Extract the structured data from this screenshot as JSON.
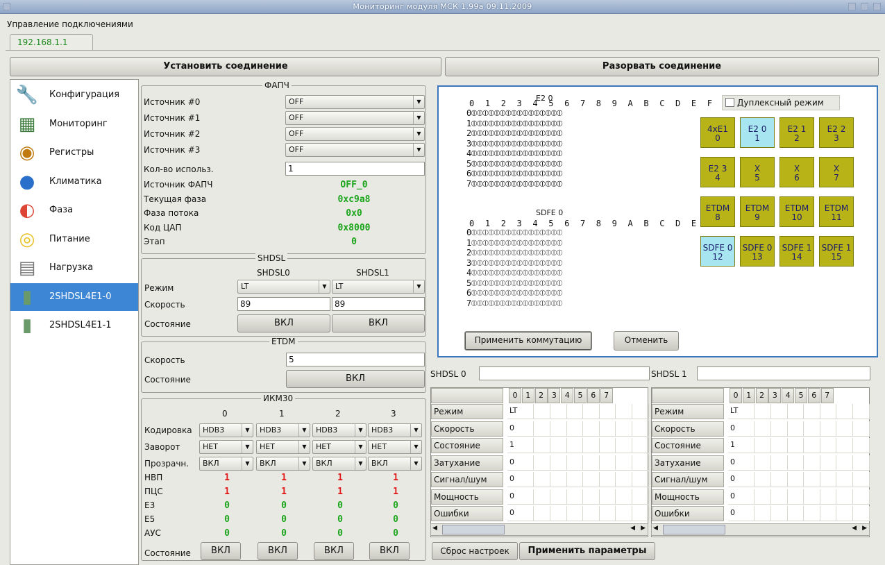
{
  "window": {
    "title": "Мониторинг модуля МСК 1.99а 09.11.2009"
  },
  "menu": {
    "label": "Управление подключениями"
  },
  "tab": {
    "label": "192.168.1.1"
  },
  "toolbar": {
    "connect": "Установить соединение",
    "disconnect": "Разорвать соединение"
  },
  "sidebar": {
    "items": [
      {
        "label": "Конфигурация",
        "icon": "wrench-icon"
      },
      {
        "label": "Мониторинг",
        "icon": "monitor-icon"
      },
      {
        "label": "Регистры",
        "icon": "registers-icon"
      },
      {
        "label": "Климатика",
        "icon": "globe-icon"
      },
      {
        "label": "Фаза",
        "icon": "phase-icon"
      },
      {
        "label": "Питание",
        "icon": "lightbulb-icon"
      },
      {
        "label": "Нагрузка",
        "icon": "server-icon"
      },
      {
        "label": "2SHDSL4E1-0",
        "icon": "board-icon"
      },
      {
        "label": "2SHDSL4E1-1",
        "icon": "board-icon"
      }
    ],
    "selected": 7
  },
  "pll": {
    "title": "ФАПЧ",
    "sources": [
      {
        "label": "Источник #0",
        "value": "OFF"
      },
      {
        "label": "Источник #1",
        "value": "OFF"
      },
      {
        "label": "Источник #2",
        "value": "OFF"
      },
      {
        "label": "Источник #3",
        "value": "OFF"
      }
    ],
    "used_label": "Кол-во использ.",
    "used_value": "1",
    "readouts": [
      {
        "label": "Источник ФАПЧ",
        "value": "OFF_0"
      },
      {
        "label": "Текущая фаза",
        "value": "0xc9a8"
      },
      {
        "label": "Фаза потока",
        "value": "0x0"
      },
      {
        "label": "Код ЦАП",
        "value": "0x8000"
      },
      {
        "label": "Этап",
        "value": "0"
      }
    ]
  },
  "shdsl": {
    "title": "SHDSL",
    "col0": "SHDSL0",
    "col1": "SHDSL1",
    "mode_label": "Режим",
    "mode0": "LT",
    "mode1": "LT",
    "speed_label": "Скорость",
    "speed0": "89",
    "speed1": "89",
    "state_label": "Состояние",
    "state0": "ВКЛ",
    "state1": "ВКЛ"
  },
  "etdm": {
    "title": "ETDM",
    "speed_label": "Скорость",
    "speed": "5",
    "state_label": "Состояние",
    "state": "ВКЛ"
  },
  "ikm": {
    "title": "ИКМ30",
    "cols": [
      "0",
      "1",
      "2",
      "3"
    ],
    "coding_label": "Кодировка",
    "coding": [
      "HDB3",
      "HDB3",
      "HDB3",
      "HDB3"
    ],
    "loop_label": "Заворот",
    "loop": [
      "НЕТ",
      "НЕТ",
      "НЕТ",
      "НЕТ"
    ],
    "transp_label": "Прозрачн.",
    "transp": [
      "ВКЛ",
      "ВКЛ",
      "ВКЛ",
      "ВКЛ"
    ],
    "counters": [
      {
        "label": "НВП",
        "values": [
          "1",
          "1",
          "1",
          "1"
        ],
        "color": "#e01818"
      },
      {
        "label": "ПЦС",
        "values": [
          "1",
          "1",
          "1",
          "1"
        ],
        "color": "#e01818"
      },
      {
        "label": "E3",
        "values": [
          "0",
          "0",
          "0",
          "0"
        ],
        "color": "#1aa51a"
      },
      {
        "label": "E5",
        "values": [
          "0",
          "0",
          "0",
          "0"
        ],
        "color": "#1aa51a"
      },
      {
        "label": "АУС",
        "values": [
          "0",
          "0",
          "0",
          "0"
        ],
        "color": "#1aa51a"
      }
    ],
    "state_label": "Состояние",
    "state": [
      "ВКЛ",
      "ВКЛ",
      "ВКЛ",
      "ВКЛ"
    ]
  },
  "matrix": {
    "e20_title": "E2 0",
    "sdfe_title": "SDFE 0",
    "header": "0123456789ABCDEF",
    "rows": [
      "0",
      "1",
      "2",
      "3",
      "4",
      "5",
      "6",
      "7"
    ],
    "duplex_label": "Дуплексный режим",
    "apply": "Применить коммутацию",
    "cancel": "Отменить",
    "cells": [
      {
        "name": "4xE1",
        "num": "0",
        "color": "olive"
      },
      {
        "name": "E2 0",
        "num": "1",
        "color": "cyan"
      },
      {
        "name": "E2 1",
        "num": "2",
        "color": "olive"
      },
      {
        "name": "E2 2",
        "num": "3",
        "color": "olive"
      },
      {
        "name": "E2 3",
        "num": "4",
        "color": "olive"
      },
      {
        "name": "X",
        "num": "5",
        "color": "olive"
      },
      {
        "name": "X",
        "num": "6",
        "color": "olive"
      },
      {
        "name": "X",
        "num": "7",
        "color": "olive"
      },
      {
        "name": "ETDM",
        "num": "8",
        "color": "olive"
      },
      {
        "name": "ETDM",
        "num": "9",
        "color": "olive"
      },
      {
        "name": "ETDM",
        "num": "10",
        "color": "olive"
      },
      {
        "name": "ETDM",
        "num": "11",
        "color": "olive"
      },
      {
        "name": "SDFE 0",
        "num": "12",
        "color": "cyan"
      },
      {
        "name": "SDFE 0",
        "num": "13",
        "color": "olive"
      },
      {
        "name": "SDFE 1",
        "num": "14",
        "color": "olive"
      },
      {
        "name": "SDFE 1",
        "num": "15",
        "color": "olive"
      }
    ]
  },
  "tables": [
    {
      "title": "SHDSL 0",
      "input": "",
      "cols": [
        "0",
        "1",
        "2",
        "3",
        "4",
        "5",
        "6",
        "7"
      ],
      "rows": [
        {
          "label": "Режим",
          "v0": "LT"
        },
        {
          "label": "Скорость",
          "v0": "0"
        },
        {
          "label": "Состояние",
          "v0": "1"
        },
        {
          "label": "Затухание",
          "v0": "0"
        },
        {
          "label": "Сигнал/шум",
          "v0": "0"
        },
        {
          "label": "Мощность",
          "v0": "0"
        },
        {
          "label": "Ошибки",
          "v0": "0"
        }
      ]
    },
    {
      "title": "SHDSL 1",
      "input": "",
      "cols": [
        "0",
        "1",
        "2",
        "3",
        "4",
        "5",
        "6",
        "7"
      ],
      "rows": [
        {
          "label": "Режим",
          "v0": "LT"
        },
        {
          "label": "Скорость",
          "v0": "0"
        },
        {
          "label": "Состояние",
          "v0": "1"
        },
        {
          "label": "Затухание",
          "v0": "0"
        },
        {
          "label": "Сигнал/шум",
          "v0": "0"
        },
        {
          "label": "Мощность",
          "v0": "0"
        },
        {
          "label": "Ошибки",
          "v0": "0"
        }
      ]
    }
  ],
  "bottom": {
    "reset": "Сброс настроек",
    "apply": "Применить параметры"
  }
}
